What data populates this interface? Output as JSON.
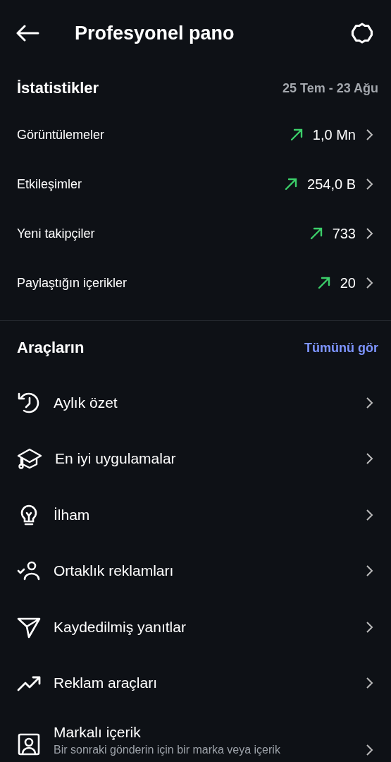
{
  "header": {
    "title": "Profesyonel pano"
  },
  "stats": {
    "title": "İstatistikler",
    "date_range": "25 Tem - 23 Ağu",
    "rows": [
      {
        "label": "Görüntülemeler",
        "value": "1,0 Mn"
      },
      {
        "label": "Etkileşimler",
        "value": "254,0 B"
      },
      {
        "label": "Yeni takipçiler",
        "value": "733"
      },
      {
        "label": "Paylaştığın içerikler",
        "value": "20"
      }
    ]
  },
  "tools": {
    "title": "Araçların",
    "see_all": "Tümünü gör",
    "items": [
      {
        "kind": "history",
        "label": "Aylık özet"
      },
      {
        "kind": "cap",
        "label": "En iyi uygulamalar"
      },
      {
        "kind": "bulb",
        "label": "İlham"
      },
      {
        "kind": "partner",
        "label": "Ortaklık reklamları"
      },
      {
        "kind": "send",
        "label": "Kaydedilmiş yanıtlar"
      },
      {
        "kind": "trend",
        "label": "Reklam araçları"
      },
      {
        "kind": "badge",
        "label": "Markalı içerik",
        "subtitle": "Bir sonraki gönderin için bir marka veya içerik"
      }
    ]
  }
}
